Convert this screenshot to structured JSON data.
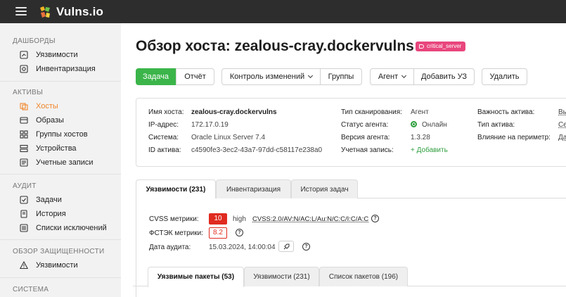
{
  "app": {
    "title": "Vulns.io"
  },
  "sidebar": {
    "sections": [
      {
        "title": "ДАШБОРДЫ",
        "items": [
          {
            "label": "Уязвимости",
            "icon": "vulnerability-chart-icon"
          },
          {
            "label": "Инвентаризация",
            "icon": "inventory-chart-icon"
          }
        ]
      },
      {
        "title": "АКТИВЫ",
        "items": [
          {
            "label": "Хосты",
            "icon": "hosts-icon",
            "active": true
          },
          {
            "label": "Образы",
            "icon": "images-icon"
          },
          {
            "label": "Группы хостов",
            "icon": "host-groups-icon"
          },
          {
            "label": "Устройства",
            "icon": "devices-icon"
          },
          {
            "label": "Учетные записи",
            "icon": "accounts-icon"
          }
        ]
      },
      {
        "title": "АУДИТ",
        "items": [
          {
            "label": "Задачи",
            "icon": "tasks-icon"
          },
          {
            "label": "История",
            "icon": "history-icon"
          },
          {
            "label": "Списки исключений",
            "icon": "exclusions-icon"
          }
        ]
      },
      {
        "title": "ОБЗОР ЗАЩИЩЕННОСТИ",
        "items": [
          {
            "label": "Уязвимости",
            "icon": "warning-icon"
          }
        ]
      },
      {
        "title": "СИСТЕМА",
        "items": []
      }
    ]
  },
  "page": {
    "title": "Обзор хоста: zealous-cray.dockervulns",
    "tag": "critical_server"
  },
  "toolbar": {
    "task": "Задача",
    "report": "Отчёт",
    "change_control": "Контроль изменений",
    "groups": "Группы",
    "agent": "Агент",
    "add_account": "Добавить УЗ",
    "delete": "Удалить"
  },
  "host_info": {
    "hostname_label": "Имя хоста:",
    "hostname": "zealous-cray.dockervulns",
    "ip_label": "IP-адрес:",
    "ip": "172.17.0.19",
    "system_label": "Система:",
    "system": "Oracle Linux Server 7.4",
    "asset_id_label": "ID актива:",
    "asset_id": "c4590fe3-3ec2-43a7-97dd-c58117e238a0",
    "scan_type_label": "Тип сканирования:",
    "scan_type": "Агент",
    "agent_status_label": "Статус агента:",
    "agent_status": "Онлайн",
    "agent_version_label": "Версия агента:",
    "agent_version": "1.3.28",
    "account_label": "Учетная запись:",
    "account_add": "+ Добавить",
    "importance_label": "Важность актива:",
    "importance": "Вы",
    "asset_type_label": "Тип актива:",
    "asset_type": "Се",
    "perimeter_label": "Влияние на периметр:",
    "perimeter": "Да"
  },
  "tabs": [
    {
      "label": "Уязвимости (231)",
      "active": true
    },
    {
      "label": "Инвентаризация"
    },
    {
      "label": "История задач"
    }
  ],
  "metrics": {
    "cvss_label": "CVSS метрики:",
    "cvss_score": "10",
    "cvss_severity": "high",
    "cvss_vector": "CVSS:2.0/AV:N/AC:L/Au:N/C:C/I:C/A:C",
    "fstec_label": "ФСТЭК метрики:",
    "fstec_score": "8.2",
    "audit_date_label": "Дата аудита:",
    "audit_date": "15.03.2024, 14:00:04",
    "help_glyph": "?"
  },
  "subtabs": [
    {
      "label": "Уязвимые пакеты (53)",
      "active": true
    },
    {
      "label": "Уязвимости (231)"
    },
    {
      "label": "Список пакетов (196)"
    }
  ],
  "colors": {
    "accent_green": "#3bb54a",
    "accent_orange": "#f0852a",
    "tag_pink": "#e8467c",
    "severity_red": "#e02b20"
  }
}
